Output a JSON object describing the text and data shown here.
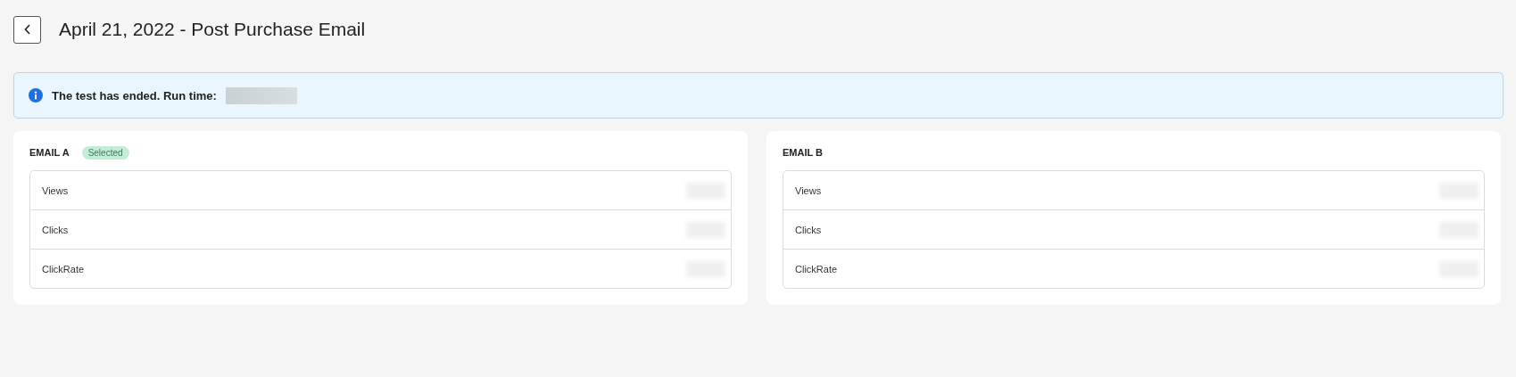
{
  "header": {
    "title": "April 21, 2022 - Post Purchase Email"
  },
  "banner": {
    "text": "The test has ended. Run time:"
  },
  "selected_badge": "Selected",
  "emails": [
    {
      "title": "EMAIL A",
      "selected": true,
      "metrics": [
        "Views",
        "Clicks",
        "ClickRate"
      ]
    },
    {
      "title": "EMAIL B",
      "selected": false,
      "metrics": [
        "Views",
        "Clicks",
        "ClickRate"
      ]
    }
  ]
}
